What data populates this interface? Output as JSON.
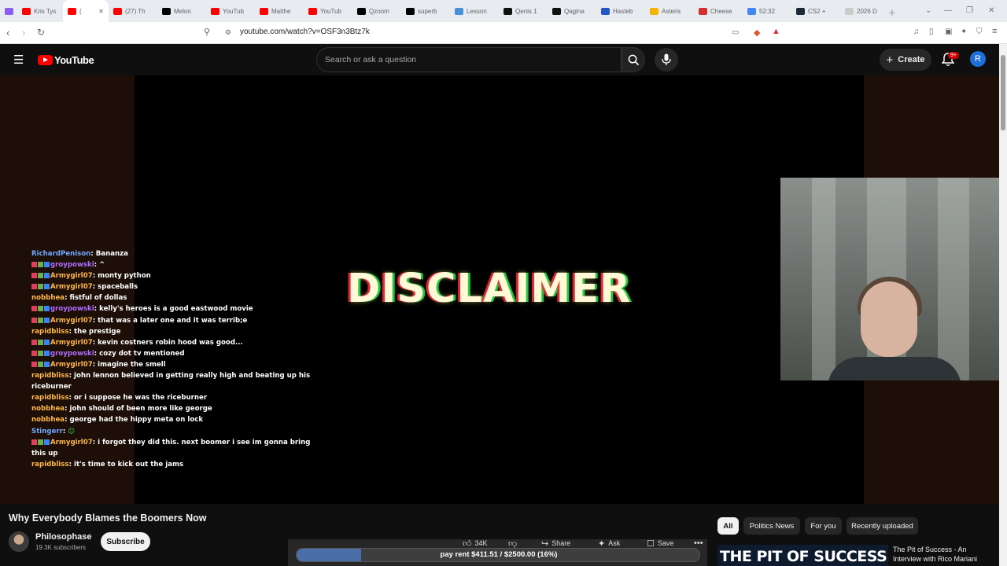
{
  "browser": {
    "tabs": [
      {
        "label": "",
        "color": "#8b5cf6"
      },
      {
        "label": "Kris Tys",
        "color": "#ff0000"
      },
      {
        "label": "(",
        "color": "#ff0000",
        "active": true
      },
      {
        "label": "(27) Th",
        "color": "#ff0000"
      },
      {
        "label": "Melon",
        "color": "#000000"
      },
      {
        "label": "YouTub",
        "color": "#ff0000"
      },
      {
        "label": "Matthe",
        "color": "#ff0000"
      },
      {
        "label": "YouTub",
        "color": "#ff0000"
      },
      {
        "label": "Qzoom",
        "color": "#000000"
      },
      {
        "label": "superb",
        "color": "#000000"
      },
      {
        "label": "Lesson",
        "color": "#4a90d9"
      },
      {
        "label": "Qenis 1",
        "color": "#111111"
      },
      {
        "label": "Qagina",
        "color": "#111111"
      },
      {
        "label": "Hasteb",
        "color": "#2457c5"
      },
      {
        "label": "Asteris",
        "color": "#f5b400"
      },
      {
        "label": "Cheese",
        "color": "#d32f2f"
      },
      {
        "label": "52:32",
        "color": "#4285f4"
      },
      {
        "label": "CS2 +",
        "color": "#1b2838"
      },
      {
        "label": "2026 D",
        "color": "#cccccc"
      }
    ],
    "url": "youtube.com/watch?v=OSF3n3Btz7k"
  },
  "header": {
    "logo_text": "YouTube",
    "search_placeholder": "Search or ask a question",
    "create_label": "Create",
    "notif_count": "9+",
    "avatar_letter": "R"
  },
  "player": {
    "overlay_text": "DISCLAIMER"
  },
  "chat": [
    {
      "user": "RichardPenison",
      "color": "#6fa8ff",
      "badges": false,
      "text": "Bananza"
    },
    {
      "user": "groypowski",
      "color": "#b06cff",
      "badges": true,
      "text": "^"
    },
    {
      "user": "Armygirl07",
      "color": "#ffb84d",
      "badges": true,
      "text": "monty python"
    },
    {
      "user": "Armygirl07",
      "color": "#ffb84d",
      "badges": true,
      "text": "spaceballs"
    },
    {
      "user": "nobbhea",
      "color": "#ffb84d",
      "badges": false,
      "text": "fistful of dollas"
    },
    {
      "user": "groypowski",
      "color": "#b06cff",
      "badges": true,
      "text": "kelly's heroes is a good eastwood movie"
    },
    {
      "user": "Armygirl07",
      "color": "#ffb84d",
      "badges": true,
      "text": "that was a later one and it was terrib;e"
    },
    {
      "user": "rapidbliss",
      "color": "#ffb84d",
      "badges": false,
      "text": "the prestige"
    },
    {
      "user": "Armygirl07",
      "color": "#ffb84d",
      "badges": true,
      "text": "kevin costners robin hood was good..."
    },
    {
      "user": "groypowski",
      "color": "#b06cff",
      "badges": true,
      "text": "cozy dot tv mentioned"
    },
    {
      "user": "Armygirl07",
      "color": "#ffb84d",
      "badges": true,
      "text": "imagine the smell"
    },
    {
      "user": "rapidbliss",
      "color": "#ffb84d",
      "badges": false,
      "text": "john lennon believed in getting really high and beating up his riceburner"
    },
    {
      "user": "rapidbliss",
      "color": "#ffb84d",
      "badges": false,
      "text": "or i suppose he was the riceburner"
    },
    {
      "user": "nobbhea",
      "color": "#ffb84d",
      "badges": false,
      "text": "john should of been more like george"
    },
    {
      "user": "nobbhea",
      "color": "#ffb84d",
      "badges": false,
      "text": "george had the hippy meta on lock"
    },
    {
      "user": "Stingerr",
      "color": "#6fa8ff",
      "badges": false,
      "text": "☺"
    },
    {
      "user": "Armygirl07",
      "color": "#ffb84d",
      "badges": true,
      "text": "i forgot they did this. next boomer i see im gonna bring this up"
    },
    {
      "user": "rapidbliss",
      "color": "#ffb84d",
      "badges": false,
      "text": "it's time to kick out the jams"
    }
  ],
  "video": {
    "title": "Why Everybody Blames the Boomers Now",
    "channel": "Philosophase",
    "subscribers": "19.3K subscribers",
    "subscribe_label": "Subscribe",
    "like_count": "34K",
    "share_label": "Share",
    "ask_label": "Ask",
    "save_label": "Save"
  },
  "rent_bar": {
    "text": "pay rent $411.51 / $2500.00 (16%)",
    "progress": 0.16
  },
  "chips": [
    "All",
    "Politics News",
    "For you",
    "Recently uploaded"
  ],
  "recommendation": {
    "thumb_text": "THE PIT OF SUCCESS",
    "title": "The Pit of Success - An Interview with Rico Mariani"
  }
}
